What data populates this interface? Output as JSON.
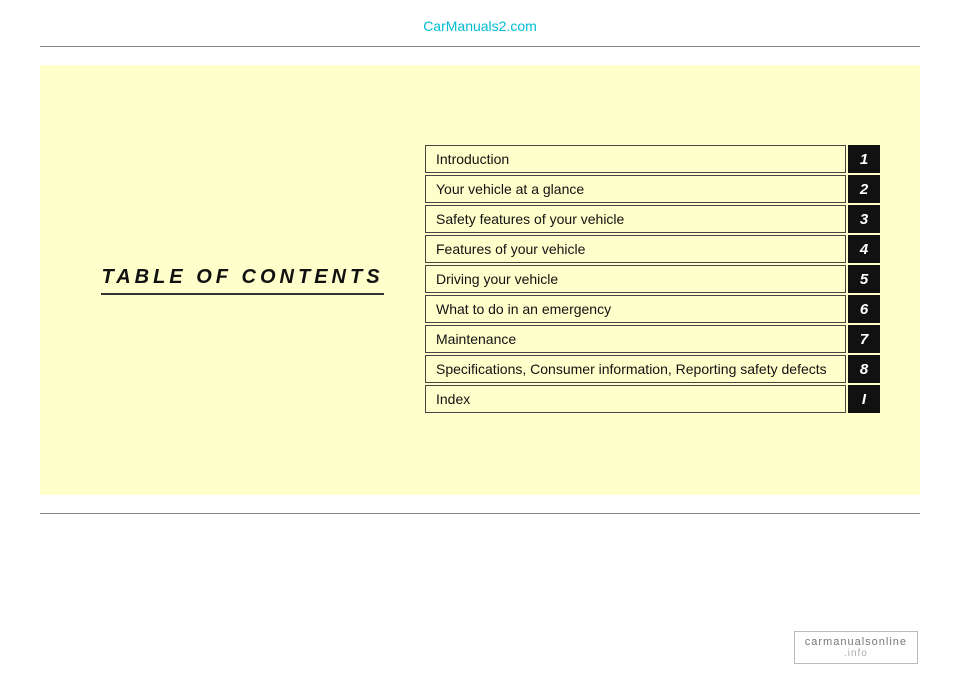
{
  "site": {
    "url_label": "CarManuals2.com"
  },
  "toc": {
    "title": "TABLE  OF  CONTENTS",
    "items": [
      {
        "label": "Introduction",
        "number": "1"
      },
      {
        "label": "Your vehicle at a glance",
        "number": "2"
      },
      {
        "label": "Safety features of your vehicle",
        "number": "3"
      },
      {
        "label": "Features of your vehicle",
        "number": "4"
      },
      {
        "label": "Driving your vehicle",
        "number": "5"
      },
      {
        "label": "What to do in an emergency",
        "number": "6"
      },
      {
        "label": "Maintenance",
        "number": "7"
      },
      {
        "label": "Specifications, Consumer information, Reporting safety defects",
        "number": "8"
      },
      {
        "label": "Index",
        "number": "I"
      }
    ]
  },
  "watermark": {
    "line1": "carmanualsonline",
    "line2": ".info"
  }
}
